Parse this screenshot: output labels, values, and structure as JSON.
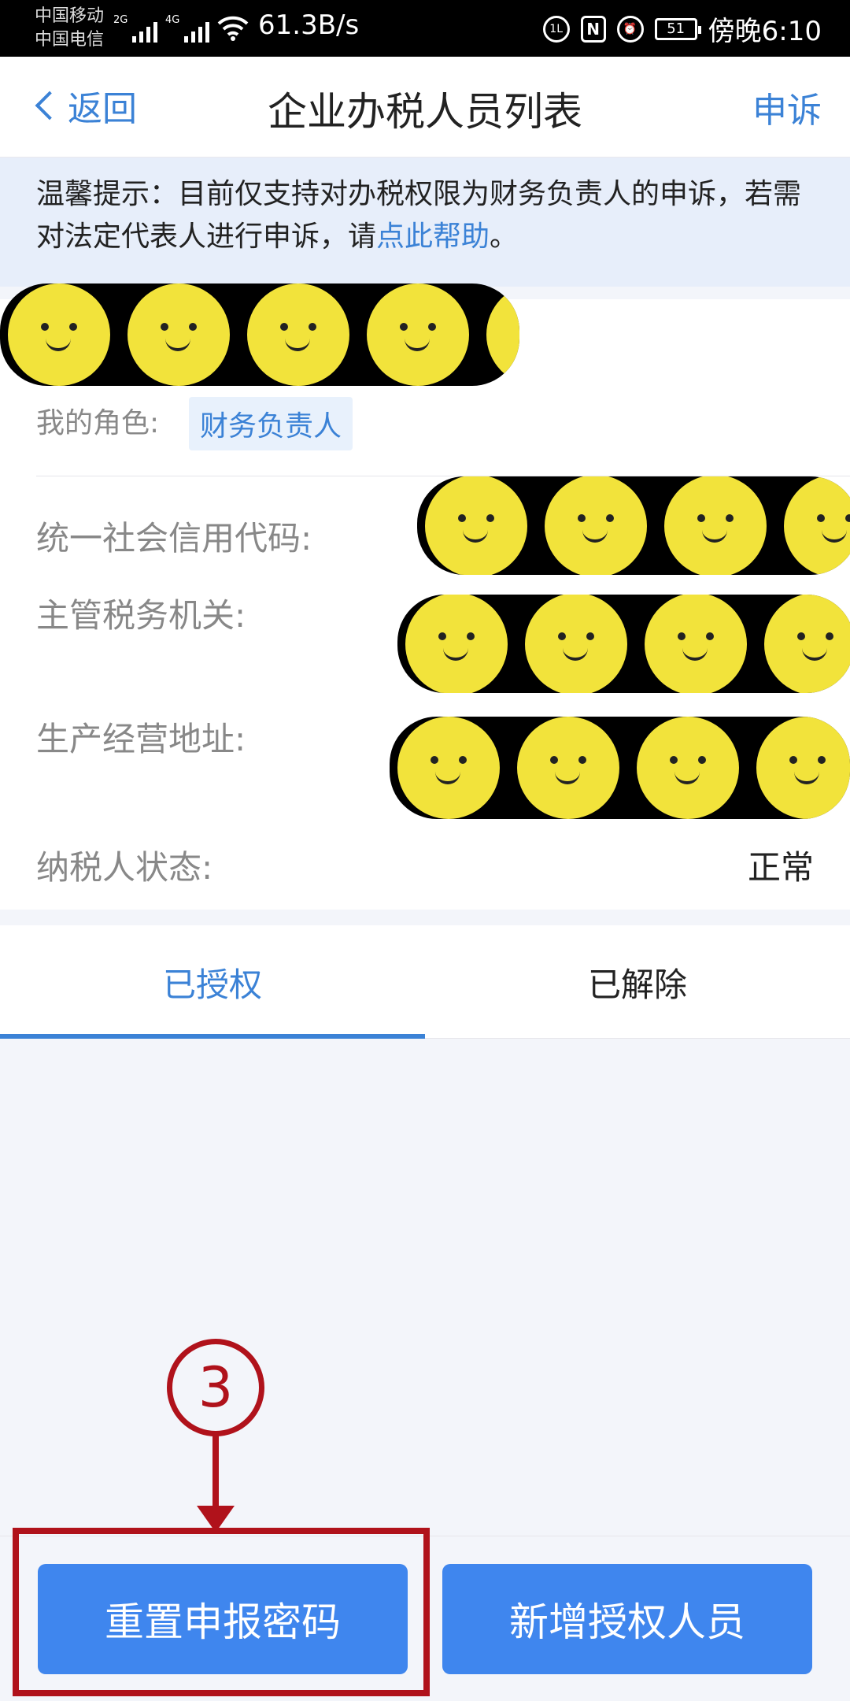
{
  "status_bar": {
    "carrier_1": "中国移动",
    "carrier_2": "中国电信",
    "net_1": "2G",
    "net_2": "4G",
    "speed": "61.3B/s",
    "battery": "51",
    "time": "傍晚6:10",
    "icons": [
      "signal-icon",
      "wifi-icon",
      "hd-icon",
      "nfc-icon",
      "alarm-icon",
      "battery-icon"
    ]
  },
  "nav": {
    "back_label": "返回",
    "title": "企业办税人员列表",
    "appeal_label": "申诉"
  },
  "notice": {
    "text": "温馨提示：目前仅支持对办税权限为财务负责人的申诉，若需对法定代表人进行申诉，请",
    "link": "点此帮助",
    "suffix": "。"
  },
  "company": {
    "role_label": "我的角色:",
    "role_value": "财务负责人",
    "fields": [
      {
        "label": "统一社会信用代码:",
        "value": ""
      },
      {
        "label": "主管税务机关:",
        "value": ""
      },
      {
        "label": "生产经营地址:",
        "value": ""
      },
      {
        "label": "纳税人状态:",
        "value": "正常"
      }
    ]
  },
  "tabs": [
    {
      "label": "已授权",
      "active": true
    },
    {
      "label": "已解除",
      "active": false
    }
  ],
  "annotation": {
    "step": "3"
  },
  "buttons": {
    "reset": "重置申报密码",
    "add": "新增授权人员"
  },
  "colors": {
    "accent": "#3b82d6",
    "button": "#3f86ee",
    "annotation": "#b0121b",
    "redaction": "#f2e33b"
  }
}
